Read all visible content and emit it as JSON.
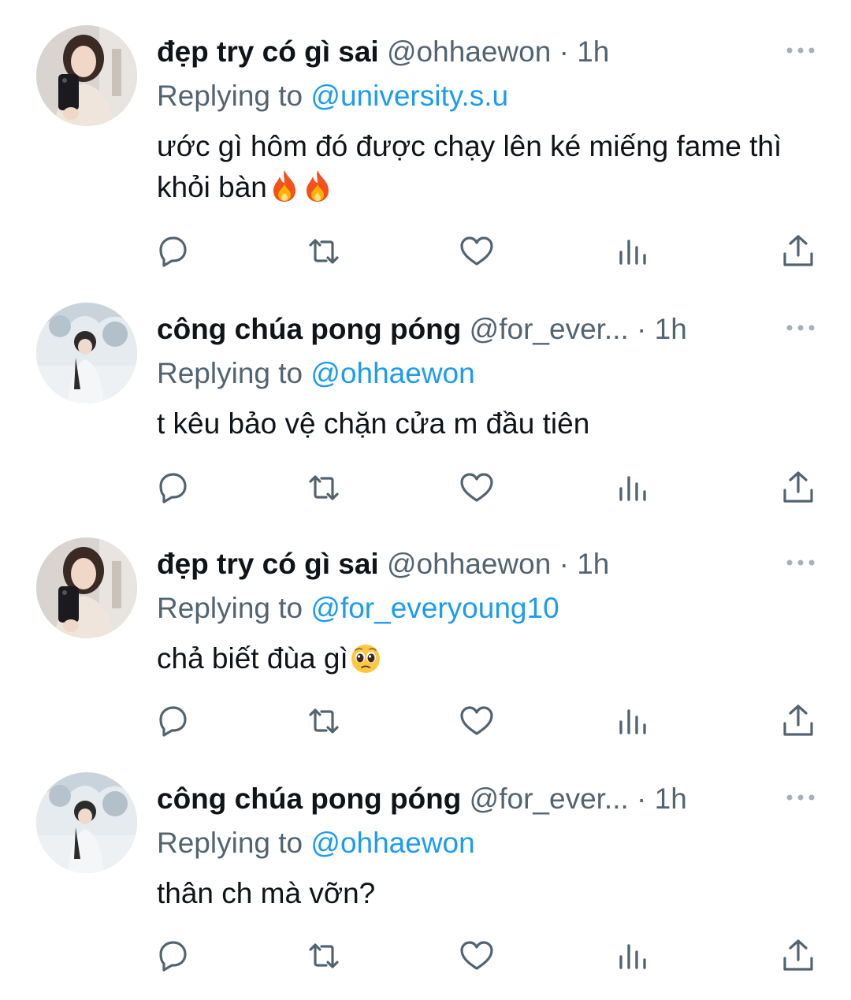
{
  "colors": {
    "text": "#0f1419",
    "secondary": "#536471",
    "link": "#1d9bf0"
  },
  "tweets": [
    {
      "avatar": "avatar-girl-mirror-selfie",
      "display_name": "đẹp try có gì sai",
      "handle": "@ohhaewon",
      "separator": "·",
      "time": "1h",
      "reply_prefix": "Replying to",
      "reply_to": "@university.s.u",
      "text": "ước gì hôm đó được chạy lên ké miếng fame thì khỏi bàn",
      "text_emoji": [
        "fire-emoji",
        "fire-emoji"
      ]
    },
    {
      "avatar": "avatar-girl-snow-scene",
      "display_name": "công chúa pong póng",
      "handle": "@for_ever...",
      "separator": "·",
      "time": "1h",
      "reply_prefix": "Replying to",
      "reply_to": "@ohhaewon",
      "text": "t kêu bảo vệ chặn cửa m đầu tiên",
      "text_emoji": []
    },
    {
      "avatar": "avatar-girl-mirror-selfie",
      "display_name": "đẹp try có gì sai",
      "handle": "@ohhaewon",
      "separator": "·",
      "time": "1h",
      "reply_prefix": "Replying to",
      "reply_to": "@for_everyoung10",
      "text": "chả biết đùa gì",
      "text_emoji": [
        "pleading-face-emoji"
      ]
    },
    {
      "avatar": "avatar-girl-snow-scene",
      "display_name": "công chúa pong póng",
      "handle": "@for_ever...",
      "separator": "·",
      "time": "1h",
      "reply_prefix": "Replying to",
      "reply_to": "@ohhaewon",
      "text": "thân ch mà vỡn?",
      "text_emoji": []
    }
  ],
  "actions": [
    "reply-icon",
    "retweet-icon",
    "like-icon",
    "views-icon",
    "share-icon"
  ]
}
